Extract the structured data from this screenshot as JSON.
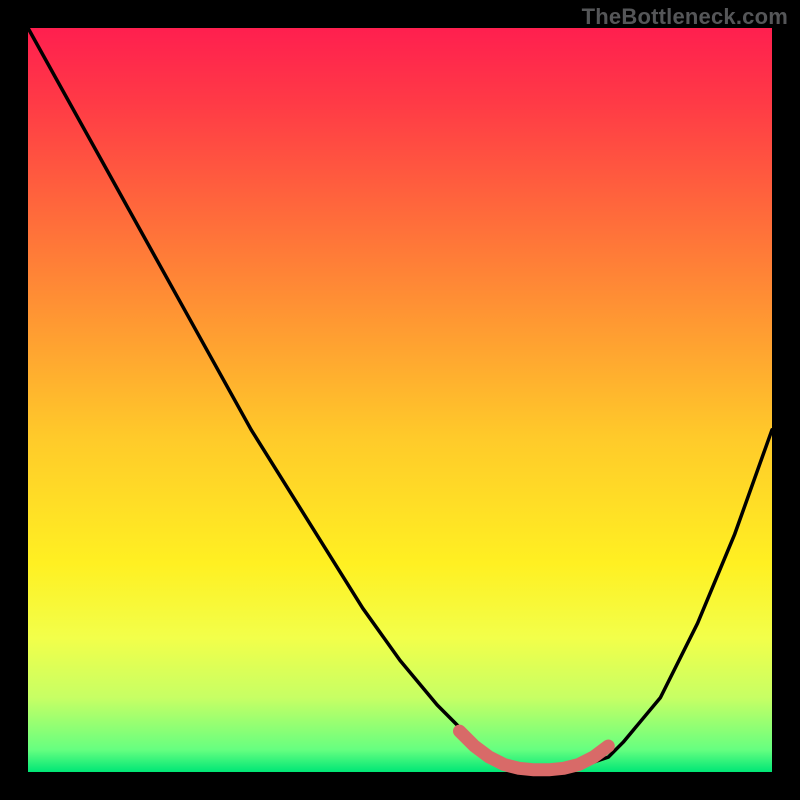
{
  "watermark": "TheBottleneck.com",
  "chart_data": {
    "type": "line",
    "title": "",
    "xlabel": "",
    "ylabel": "",
    "xlim": [
      0,
      100
    ],
    "ylim": [
      0,
      100
    ],
    "series": [
      {
        "name": "bottleneck-curve",
        "x": [
          0,
          5,
          10,
          15,
          20,
          25,
          30,
          35,
          40,
          45,
          50,
          55,
          58,
          60,
          62,
          65,
          68,
          72,
          75,
          78,
          80,
          85,
          90,
          95,
          100
        ],
        "y": [
          100,
          91,
          82,
          73,
          64,
          55,
          46,
          38,
          30,
          22,
          15,
          9,
          6,
          4,
          2,
          1,
          0,
          0,
          1,
          2,
          4,
          10,
          20,
          32,
          46
        ]
      }
    ],
    "highlight": {
      "name": "flat-minimum",
      "x": [
        58,
        60,
        62,
        64,
        66,
        68,
        70,
        72,
        74,
        76,
        78
      ],
      "y": [
        5.5,
        3.5,
        2,
        1,
        0.5,
        0.3,
        0.3,
        0.5,
        1,
        2,
        3.5
      ]
    },
    "colors": {
      "curve": "#000000",
      "highlight": "#d86a68",
      "gradient_top": "#ff1f4f",
      "gradient_bottom": "#00e676"
    }
  }
}
